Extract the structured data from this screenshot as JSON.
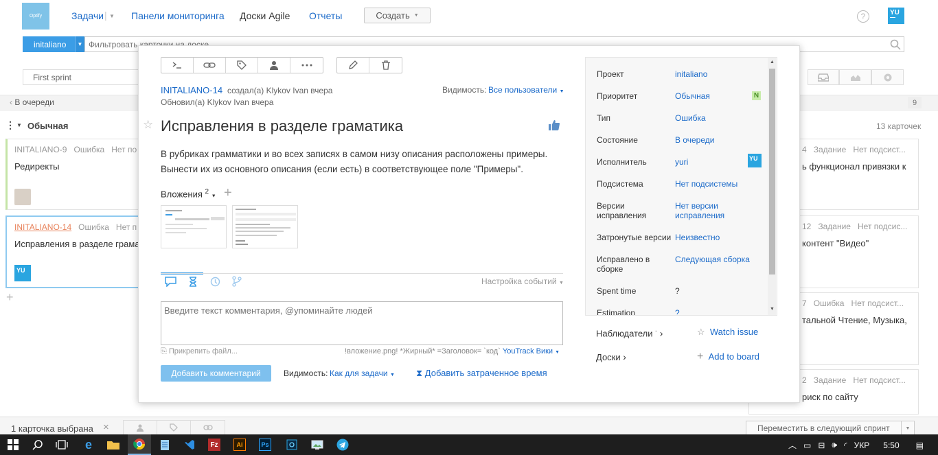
{
  "app": {
    "logo_text": "Optify",
    "nav": [
      "Задачи",
      "Панели мониторинга",
      "Доски Agile",
      "Отчеты"
    ],
    "create_label": "Создать",
    "help_label": "?",
    "user_initials": "YU"
  },
  "search": {
    "project": "initaliano",
    "placeholder": "Фильтровать карточки на доске"
  },
  "board": {
    "sprint": "First sprint",
    "column_name": "В очереди",
    "column_count": "9",
    "swimlane": "Обычная",
    "swimlane_count": "13 карточек",
    "cards": [
      {
        "id": "INITALIANO-9",
        "type": "Ошибка",
        "subsystem": "Нет по",
        "title": "Редиректы"
      },
      {
        "id": "INITALIANO-14",
        "type": "Ошибка",
        "subsystem": "Нет п",
        "title": "Исправления в разделе грама",
        "avatar": "YU"
      }
    ],
    "right_cards": [
      {
        "id": "4",
        "type": "Задание",
        "subsystem": "Нет подсист...",
        "title": "ь функционал привязки к"
      },
      {
        "id": "12",
        "type": "Задание",
        "subsystem": "Нет подсис...",
        "title": "контент \"Видео\""
      },
      {
        "id": "7",
        "type": "Ошибка",
        "subsystem": "Нет подсист...",
        "title": "тальной Чтение, Музыка,"
      },
      {
        "id": "2",
        "type": "Задание",
        "subsystem": "Нет подсист...",
        "title": "риск по сайту"
      }
    ],
    "selected_text": "1 карточка выбрана",
    "move_label": "Переместить в следующий спринт"
  },
  "issue": {
    "id": "INITALIANO-14",
    "created": "создал(а) Klykov Ivan вчера",
    "updated": "Обновил(а) Klykov Ivan вчера",
    "visibility_label": "Видимость:",
    "visibility_value": "Все пользователи",
    "summary": "Исправления в разделе граматика",
    "description": "В рубриках грамматики и во всех записях в самом низу описания расположены примеры. Вынести их из основного описания (если есть) в соответствующее поле \"Примеры\".",
    "attachments_label": "Вложения",
    "attachments_count": "2",
    "events_settings": "Настройка событий",
    "comment_placeholder": "Введите текст комментария, @упоминайте людей",
    "attach_file": "Прикрепить файл...",
    "markup_hint": "!вложение.png! *Жирный* =Заголовок= `код`",
    "wiki_link": "YouTrack Вики",
    "add_comment": "Добавить комментарий",
    "comment_visibility_label": "Видимость:",
    "comment_visibility_value": "Как для задачи",
    "add_time": "Добавить затраченное время"
  },
  "fields": [
    {
      "label": "Проект",
      "value": "initaliano"
    },
    {
      "label": "Приоритет",
      "value": "Обычная",
      "badge": "N"
    },
    {
      "label": "Тип",
      "value": "Ошибка"
    },
    {
      "label": "Состояние",
      "value": "В очереди"
    },
    {
      "label": "Исполнитель",
      "value": "yuri",
      "badge": "YU"
    },
    {
      "label": "Подсистема",
      "value": "Нет подсистемы"
    },
    {
      "label": "Версии исправления",
      "value": "Нет версии исправления"
    },
    {
      "label": "Затронутые версии",
      "value": "Неизвестно"
    },
    {
      "label": "Исправлено в сборке",
      "value": "Следующая сборка"
    },
    {
      "label": "Spent time",
      "value": "?"
    },
    {
      "label": "Estimation",
      "value": "?"
    }
  ],
  "sidebar": {
    "watchers": "Наблюдатели",
    "watch_issue": "Watch issue",
    "boards": "Доски",
    "add_board": "Add to board"
  },
  "taskbar": {
    "lang": "УКР",
    "time": "5:50"
  },
  "colors": {
    "accent": "#1b6ac9",
    "project_button": "#3b9de6",
    "add_comment_button": "#7ec0ee",
    "avatar": "#2aa5e0",
    "card_stripe": "#c4e4a6",
    "selected_card_border": "#8fcaf0"
  }
}
